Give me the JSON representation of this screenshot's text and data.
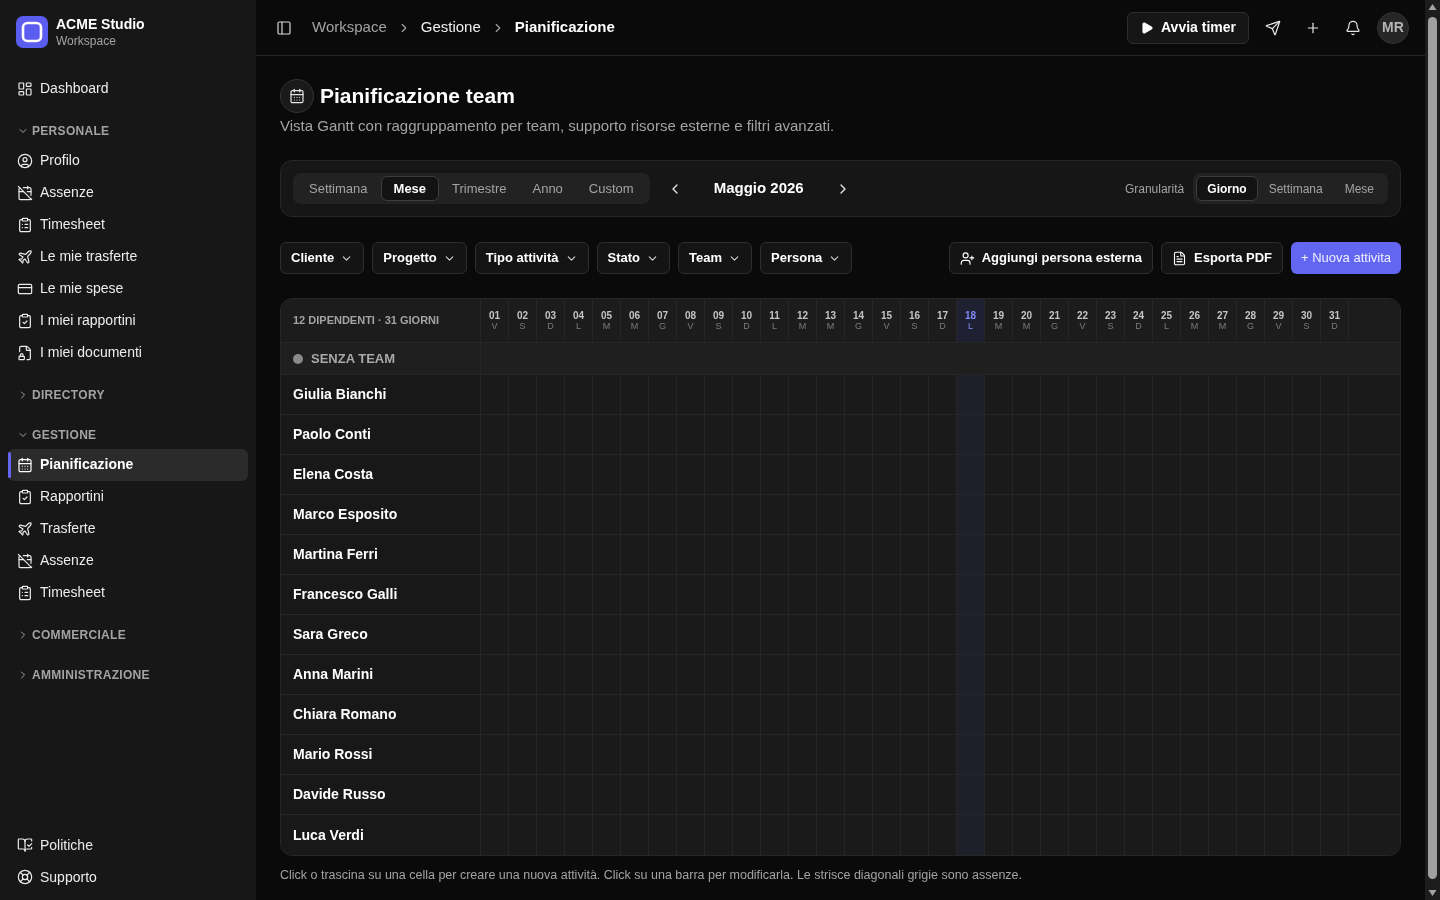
{
  "sidebar": {
    "brand": {
      "name": "ACME Studio",
      "subtitle": "Workspace"
    },
    "items": [
      {
        "label": "Dashboard",
        "selected": false
      }
    ],
    "sections": [
      {
        "title": "PERSONALE",
        "expanded": true,
        "items": [
          {
            "label": "Profilo",
            "selected": false
          },
          {
            "label": "Assenze",
            "selected": false
          },
          {
            "label": "Timesheet",
            "selected": false
          },
          {
            "label": "Le mie trasferte",
            "selected": false
          },
          {
            "label": "Le mie spese",
            "selected": false
          },
          {
            "label": "I miei rapportini",
            "selected": false
          },
          {
            "label": "I miei documenti",
            "selected": false
          }
        ]
      },
      {
        "title": "DIRECTORY",
        "expanded": false
      },
      {
        "title": "GESTIONE",
        "expanded": true,
        "items": [
          {
            "label": "Pianificazione",
            "selected": true
          },
          {
            "label": "Rapportini",
            "selected": false
          },
          {
            "label": "Trasferte",
            "selected": false
          },
          {
            "label": "Assenze",
            "selected": false
          },
          {
            "label": "Timesheet",
            "selected": false
          }
        ]
      },
      {
        "title": "COMMERCIALE",
        "expanded": false
      },
      {
        "title": "AMMINISTRAZIONE",
        "expanded": false
      }
    ],
    "footer_items": [
      {
        "label": "Politiche",
        "selected": false
      },
      {
        "label": "Supporto",
        "selected": false
      }
    ]
  },
  "topbar": {
    "breadcrumb": [
      "Workspace",
      "Gestione",
      "Pianificazione"
    ],
    "timer_button": "Avvia timer",
    "avatar": "MR"
  },
  "page": {
    "title": "Pianificazione team",
    "subtitle": "Vista Gantt con raggruppamento per team, supporto risorse esterne e filtri avanzati."
  },
  "toolbar": {
    "range_tabs": [
      {
        "label": "Settimana",
        "selected": false
      },
      {
        "label": "Mese",
        "selected": true
      },
      {
        "label": "Trimestre",
        "selected": false
      },
      {
        "label": "Anno",
        "selected": false
      },
      {
        "label": "Custom",
        "selected": false
      }
    ],
    "period": "Maggio 2026",
    "granularity_label": "Granularità",
    "granularity_tabs": [
      {
        "label": "Giorno",
        "selected": true
      },
      {
        "label": "Settimana",
        "selected": false
      },
      {
        "label": "Mese",
        "selected": false
      }
    ]
  },
  "filters": [
    "Cliente",
    "Progetto",
    "Tipo attività",
    "Stato",
    "Team",
    "Persona"
  ],
  "actions": {
    "add_external": "Aggiungi persona esterna",
    "export": "Esporta PDF",
    "create": "+ Nuova attivita"
  },
  "planner": {
    "summary": "12 DIPENDENTI · 31 GIORNI",
    "days": [
      {
        "day": "01",
        "weekday": "V",
        "today": false
      },
      {
        "day": "02",
        "weekday": "S",
        "today": false
      },
      {
        "day": "03",
        "weekday": "D",
        "today": false
      },
      {
        "day": "04",
        "weekday": "L",
        "today": false
      },
      {
        "day": "05",
        "weekday": "M",
        "today": false
      },
      {
        "day": "06",
        "weekday": "M",
        "today": false
      },
      {
        "day": "07",
        "weekday": "G",
        "today": false
      },
      {
        "day": "08",
        "weekday": "V",
        "today": false
      },
      {
        "day": "09",
        "weekday": "S",
        "today": false
      },
      {
        "day": "10",
        "weekday": "D",
        "today": false
      },
      {
        "day": "11",
        "weekday": "L",
        "today": false
      },
      {
        "day": "12",
        "weekday": "M",
        "today": false
      },
      {
        "day": "13",
        "weekday": "M",
        "today": false
      },
      {
        "day": "14",
        "weekday": "G",
        "today": false
      },
      {
        "day": "15",
        "weekday": "V",
        "today": false
      },
      {
        "day": "16",
        "weekday": "S",
        "today": false
      },
      {
        "day": "17",
        "weekday": "D",
        "today": false
      },
      {
        "day": "18",
        "weekday": "L",
        "today": true
      },
      {
        "day": "19",
        "weekday": "M",
        "today": false
      },
      {
        "day": "20",
        "weekday": "M",
        "today": false
      },
      {
        "day": "21",
        "weekday": "G",
        "today": false
      },
      {
        "day": "22",
        "weekday": "V",
        "today": false
      },
      {
        "day": "23",
        "weekday": "S",
        "today": false
      },
      {
        "day": "24",
        "weekday": "D",
        "today": false
      },
      {
        "day": "25",
        "weekday": "L",
        "today": false
      },
      {
        "day": "26",
        "weekday": "M",
        "today": false
      },
      {
        "day": "27",
        "weekday": "M",
        "today": false
      },
      {
        "day": "28",
        "weekday": "G",
        "today": false
      },
      {
        "day": "29",
        "weekday": "V",
        "today": false
      },
      {
        "day": "30",
        "weekday": "S",
        "today": false
      },
      {
        "day": "31",
        "weekday": "D",
        "today": false
      }
    ],
    "groups": [
      {
        "name": "SENZA TEAM",
        "people": [
          "Giulia Bianchi",
          "Paolo Conti",
          "Elena Costa",
          "Marco Esposito",
          "Martina Ferri",
          "Francesco Galli",
          "Sara Greco",
          "Anna Marini",
          "Chiara Romano",
          "Mario Rossi",
          "Davide Russo",
          "Luca Verdi"
        ]
      }
    ]
  },
  "hint": "Click o trascina su una cella per creare una nuova attività. Click su una barra per modificarla. Le strisce diagonali grigie sono assenze."
}
